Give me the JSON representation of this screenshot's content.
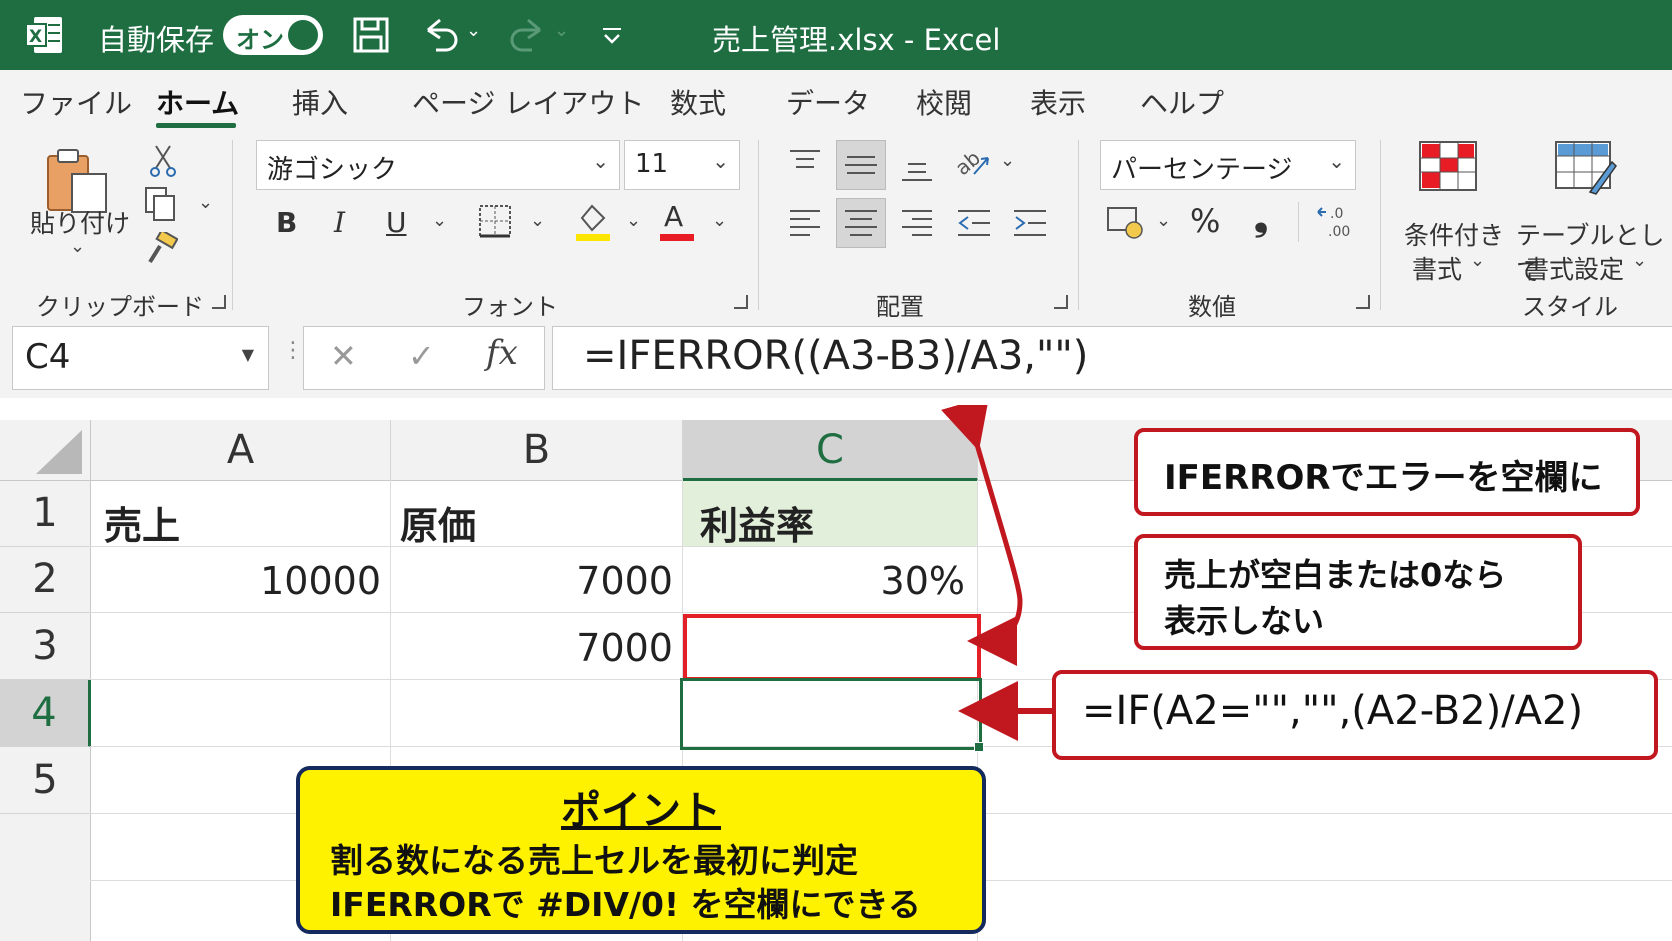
{
  "app": {
    "autosave_label": "自動保存",
    "autosave_state": "オン",
    "window_title": "売上管理.xlsx  -  Excel",
    "accent_color": "#1e6e42"
  },
  "tabs": [
    "ファイル",
    "ホーム",
    "挿入",
    "ページ レイアウト",
    "数式",
    "データ",
    "校閲",
    "表示",
    "ヘルプ"
  ],
  "active_tab": "ホーム",
  "ribbon": {
    "clipboard": {
      "paste_label": "貼り付け",
      "group_label": "クリップボード"
    },
    "font": {
      "font_name": "游ゴシック",
      "font_size": "11",
      "bold": "B",
      "italic": "I",
      "underline": "U",
      "font_color_glyph": "A",
      "group_label": "フォント"
    },
    "alignment": {
      "group_label": "配置"
    },
    "number": {
      "format": "パーセンテージ",
      "percent": "%",
      "comma": "❟",
      "group_label": "数値"
    },
    "styles": {
      "cond_format_line1": "条件付き",
      "cond_format_line2": "書式",
      "table_line1": "テーブルとして",
      "table_line2": "書式設定",
      "group_label": "スタイル"
    }
  },
  "formula_bar": {
    "name_box": "C4",
    "fx": "fx",
    "formula": "=IFERROR((A3-B3)/A3,\"\")"
  },
  "sheet": {
    "columns": [
      "A",
      "B",
      "C"
    ],
    "rows": [
      "1",
      "2",
      "3",
      "4",
      "5"
    ],
    "headers": [
      "売上",
      "原価",
      "利益率"
    ],
    "row2": [
      "10000",
      "7000",
      "30%"
    ],
    "row3": [
      "",
      "7000",
      ""
    ],
    "selected_cell": "C4"
  },
  "annotations": {
    "iferror_note": "IFERRORでエラーを空欄に",
    "blank_note_line1": "売上が空白または0なら",
    "blank_note_line2": "表示しない",
    "if_formula": "=IF(A2=\"\",\"\",(A2-B2)/A2)",
    "point_title": "ポイント",
    "point_line1": "割る数になる売上セルを最初に判定",
    "point_line2": "IFERRORで #DIV/0! を空欄にできる"
  }
}
